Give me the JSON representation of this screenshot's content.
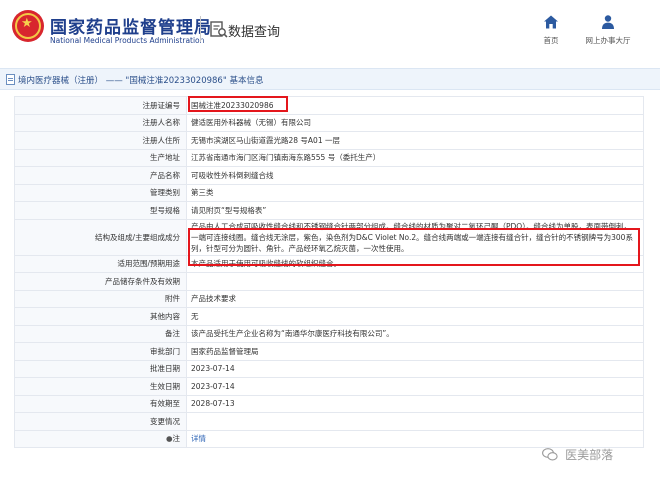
{
  "header": {
    "brand_cn": "国家药品监督管理局",
    "brand_en": "National Medical Products Administration",
    "query_label": "数据查询",
    "nav": [
      {
        "label": "首页",
        "icon": "home-icon"
      },
      {
        "label": "网上办事大厅",
        "icon": "person-icon"
      }
    ]
  },
  "titlebar": {
    "section": "境内医疗器械（注册）",
    "separator": "——",
    "record": "\"国械注准20233020986\"",
    "suffix": "基本信息"
  },
  "details": [
    {
      "key": "注册证编号",
      "value": "国械注准20233020986"
    },
    {
      "key": "注册人名称",
      "value": "健适医用外科器械（无锡）有限公司"
    },
    {
      "key": "注册人住所",
      "value": "无锡市滨湖区马山街道霞光路28 号A01 一层"
    },
    {
      "key": "生产地址",
      "value": "江苏省南通市海门区海门镇南海东路555 号（委托生产）"
    },
    {
      "key": "产品名称",
      "value": "可吸收性外科倒刺缝合线"
    },
    {
      "key": "管理类别",
      "value": "第三类"
    },
    {
      "key": "型号规格",
      "value": "请见附页“型号规格表”"
    },
    {
      "key": "结构及组成/主要组成成分",
      "value": "产品由人工合成可吸收性缝合线和不锈钢缝合针两部分组成。缝合线的材质为聚对二氧环己酮（PDO）。缝合线为单股，表面带倒刺，一端可连接线圈。缝合线无涂层，紫色，染色剂为D&C Violet No.2。缝合线两端或一端连接有缝合针，缝合针的不锈钢牌号为300系列，针型可分为圆针、角针。产品经环氧乙烷灭菌，一次性使用。"
    },
    {
      "key": "适用范围/预期用途",
      "value": "本产品适用于使用可吸收缝线的软组织缝合。"
    },
    {
      "key": "产品储存条件及有效期",
      "value": ""
    },
    {
      "key": "附件",
      "value": "产品技术要求"
    },
    {
      "key": "其他内容",
      "value": "无"
    },
    {
      "key": "备注",
      "value": "该产品受托生产企业名称为“南通华尔康医疗科技有限公司”。"
    },
    {
      "key": "审批部门",
      "value": "国家药品监督管理局"
    },
    {
      "key": "批准日期",
      "value": "2023-07-14"
    },
    {
      "key": "生效日期",
      "value": "2023-07-14"
    },
    {
      "key": "有效期至",
      "value": "2028-07-13"
    },
    {
      "key": "变更情况",
      "value": ""
    },
    {
      "key": "注",
      "value": "详情",
      "link": true
    }
  ],
  "watermark": "医美部落",
  "colors": {
    "brand_blue": "#1f3f8c",
    "emblem_red": "#d8262e",
    "annotation_red": "#e4161c",
    "link_blue": "#2a62b5",
    "nav_icon_blue": "#2c5aa0"
  }
}
